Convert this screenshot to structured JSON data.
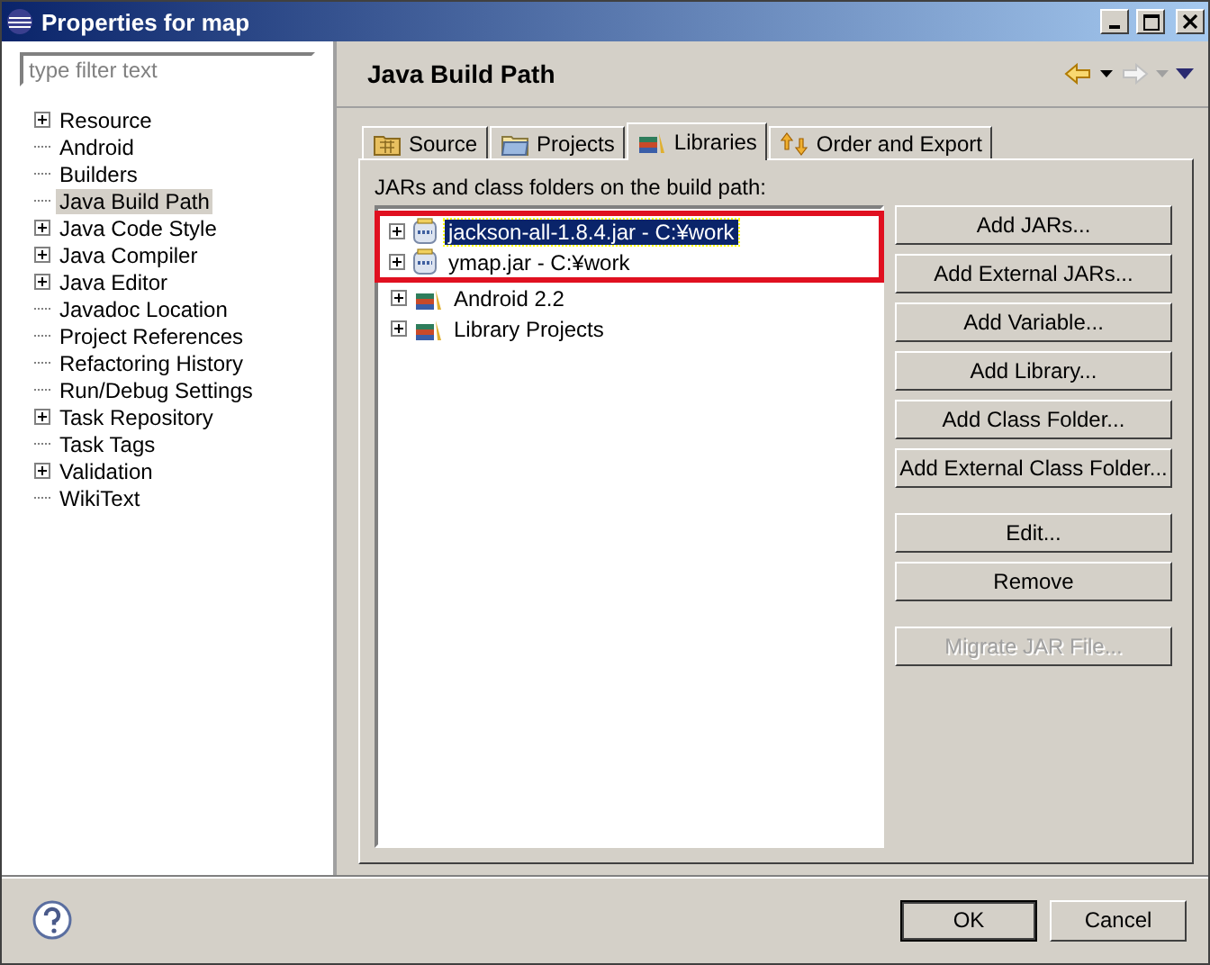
{
  "window": {
    "title": "Properties for map"
  },
  "filter": {
    "placeholder": "type filter text"
  },
  "sidebar": {
    "items": [
      {
        "label": "Resource",
        "expandable": true,
        "selected": false
      },
      {
        "label": "Android",
        "expandable": false,
        "selected": false
      },
      {
        "label": "Builders",
        "expandable": false,
        "selected": false
      },
      {
        "label": "Java Build Path",
        "expandable": false,
        "selected": true
      },
      {
        "label": "Java Code Style",
        "expandable": true,
        "selected": false
      },
      {
        "label": "Java Compiler",
        "expandable": true,
        "selected": false
      },
      {
        "label": "Java Editor",
        "expandable": true,
        "selected": false
      },
      {
        "label": "Javadoc Location",
        "expandable": false,
        "selected": false
      },
      {
        "label": "Project References",
        "expandable": false,
        "selected": false
      },
      {
        "label": "Refactoring History",
        "expandable": false,
        "selected": false
      },
      {
        "label": "Run/Debug Settings",
        "expandable": false,
        "selected": false
      },
      {
        "label": "Task Repository",
        "expandable": true,
        "selected": false
      },
      {
        "label": "Task Tags",
        "expandable": false,
        "selected": false
      },
      {
        "label": "Validation",
        "expandable": true,
        "selected": false
      },
      {
        "label": "WikiText",
        "expandable": false,
        "selected": false
      }
    ]
  },
  "page": {
    "title": "Java Build Path"
  },
  "tabs": [
    {
      "label": "Source",
      "kind": "source",
      "selected": false
    },
    {
      "label": "Projects",
      "kind": "projects",
      "selected": false
    },
    {
      "label": "Libraries",
      "kind": "libraries",
      "selected": true
    },
    {
      "label": "Order and Export",
      "kind": "order",
      "selected": false
    }
  ],
  "libraries": {
    "caption": "JARs and class folders on the build path:",
    "entries": [
      {
        "label": "jackson-all-1.8.4.jar - C:¥work",
        "kind": "jar",
        "selected": true,
        "highlighted": true
      },
      {
        "label": "ymap.jar - C:¥work",
        "kind": "jar",
        "selected": false,
        "highlighted": true
      },
      {
        "label": "Android 2.2",
        "kind": "container",
        "selected": false,
        "highlighted": false
      },
      {
        "label": "Library Projects",
        "kind": "container",
        "selected": false,
        "highlighted": false
      }
    ]
  },
  "button_groups": [
    [
      {
        "label": "Add JARs...",
        "disabled": false
      },
      {
        "label": "Add External JARs...",
        "disabled": false
      },
      {
        "label": "Add Variable...",
        "disabled": false
      },
      {
        "label": "Add Library...",
        "disabled": false
      },
      {
        "label": "Add Class Folder...",
        "disabled": false
      },
      {
        "label": "Add External Class Folder...",
        "disabled": false
      }
    ],
    [
      {
        "label": "Edit...",
        "disabled": false
      },
      {
        "label": "Remove",
        "disabled": false
      }
    ],
    [
      {
        "label": "Migrate JAR File...",
        "disabled": true
      }
    ]
  ],
  "dialog_buttons": [
    {
      "label": "OK",
      "default": true
    },
    {
      "label": "Cancel",
      "default": false
    }
  ]
}
